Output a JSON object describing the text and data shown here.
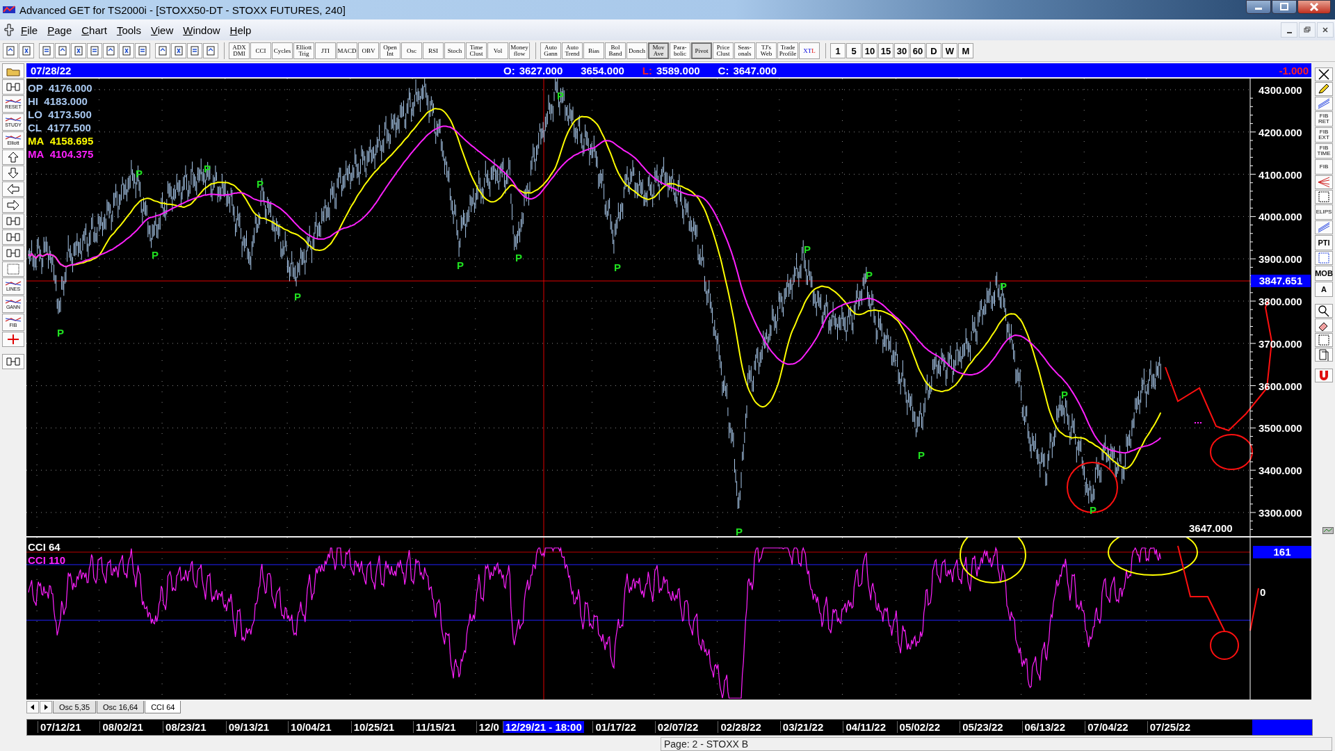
{
  "window": {
    "title": "Advanced GET for TS2000i - [STOXX50-DT - STOXX FUTURES, 240]"
  },
  "menu": [
    "File",
    "Page",
    "Chart",
    "Tools",
    "View",
    "Window",
    "Help"
  ],
  "indicator_buttons": [
    {
      "label": "ADX\nDMI",
      "on": false
    },
    {
      "label": "CCI",
      "on": false
    },
    {
      "label": "Cycles",
      "on": false
    },
    {
      "label": "Elliott\nTrig",
      "on": false
    },
    {
      "label": "JTI",
      "on": false
    },
    {
      "label": "MACD",
      "on": false
    },
    {
      "label": "OBV",
      "on": false
    },
    {
      "label": "Open\nInt",
      "on": false
    },
    {
      "label": "Osc",
      "on": false
    },
    {
      "label": "RSI",
      "on": false
    },
    {
      "label": "Stoch",
      "on": false
    },
    {
      "label": "Time\nClust",
      "on": false
    },
    {
      "label": "Vol",
      "on": false
    },
    {
      "label": "Money\nflow",
      "on": false
    }
  ],
  "study_buttons": [
    {
      "label": "Auto\nGann",
      "on": false,
      "kind": "text"
    },
    {
      "label": "Auto\nTrend",
      "on": false,
      "kind": "text"
    },
    {
      "label": "Bias",
      "on": false,
      "kind": "text"
    },
    {
      "label": "Bol\nBand",
      "on": false,
      "kind": "text"
    },
    {
      "label": "Donch",
      "on": false,
      "kind": "text"
    },
    {
      "label": "Mov\nAve",
      "on": true,
      "kind": "text"
    },
    {
      "label": "Para-\nbolic",
      "on": false,
      "kind": "text"
    },
    {
      "label": "Pivot",
      "on": true,
      "kind": "text"
    },
    {
      "label": "Price\nClust",
      "on": false,
      "kind": "text"
    },
    {
      "label": "Seas-\nonals",
      "on": false,
      "kind": "text"
    },
    {
      "label": "TJ's\nWeb",
      "on": false,
      "kind": "text"
    },
    {
      "label": "Trade\nProfile",
      "on": false,
      "kind": "text"
    },
    {
      "label": "XTL",
      "on": false,
      "kind": "xtl"
    }
  ],
  "timeframes": [
    "1",
    "5",
    "10",
    "15",
    "30",
    "60",
    "D",
    "W",
    "M"
  ],
  "left_toolbar": [
    "RESET",
    "STUDY",
    "Elliott",
    "LINES",
    "GANN",
    "FIB"
  ],
  "right_toolbar": [
    "FIB\nRET",
    "FIB\nEXT",
    "FIB\nTIME",
    "FIB",
    "ELIPS",
    "PTI",
    "MOB",
    "A"
  ],
  "info_bar": {
    "date": "07/28/22",
    "items": [
      {
        "label": "O:",
        "value": "3627.000",
        "alert": false
      },
      {
        "value": "3654.000"
      },
      {
        "label": "L:",
        "value": "3589.000",
        "alert": true
      },
      {
        "label": "C:",
        "value": "3647.000",
        "alert": false
      }
    ],
    "change": "-1.000"
  },
  "price_chart": {
    "legend": [
      {
        "label": "OP",
        "value": "4176.000",
        "color": "#a8c8f0"
      },
      {
        "label": "HI",
        "value": "4183.000",
        "color": "#a8c8f0"
      },
      {
        "label": "LO",
        "value": "4173.500",
        "color": "#a8c8f0"
      },
      {
        "label": "CL",
        "value": "4177.500",
        "color": "#a8c8f0"
      },
      {
        "label": "MA",
        "value": "4158.695",
        "color": "#ffff00"
      },
      {
        "label": "MA",
        "value": "4104.375",
        "color": "#ff20ff"
      }
    ],
    "y_axis": [
      "4300.000",
      "4200.000",
      "4100.000",
      "4000.000",
      "3900.000",
      "3800.000",
      "3700.000",
      "3600.000",
      "3500.000",
      "3400.000",
      "3300.000"
    ],
    "current_price": "3847.651",
    "last_price": "3647.000",
    "pivot_labels": [
      "P",
      "P",
      "P",
      "P",
      "P",
      "P",
      "P",
      "P",
      "P",
      "P",
      "P",
      "P",
      "P",
      "P",
      "P",
      "P",
      "P"
    ]
  },
  "cci_chart": {
    "legend": [
      {
        "label": "CCI 64",
        "color": "#ffffff"
      },
      {
        "label": "CCI  110",
        "color": "#ff20ff"
      }
    ],
    "current_value": "161",
    "zero_label": "0"
  },
  "tabs": [
    {
      "label": "Osc 5,35",
      "selected": false
    },
    {
      "label": "Osc 16,64",
      "selected": false
    },
    {
      "label": "CCI 64",
      "selected": true
    }
  ],
  "date_axis": [
    {
      "label": "07/12/21",
      "selected": false
    },
    {
      "label": "08/02/21",
      "selected": false
    },
    {
      "label": "08/23/21",
      "selected": false
    },
    {
      "label": "09/13/21",
      "selected": false
    },
    {
      "label": "10/04/21",
      "selected": false
    },
    {
      "label": "10/25/21",
      "selected": false
    },
    {
      "label": "11/15/21",
      "selected": false
    },
    {
      "label": "12/0",
      "selected": false
    },
    {
      "label": "12/29/21 - 18:00",
      "selected": true
    },
    {
      "label": "01/17/22",
      "selected": false
    },
    {
      "label": "02/07/22",
      "selected": false
    },
    {
      "label": "02/28/22",
      "selected": false
    },
    {
      "label": "03/21/22",
      "selected": false
    },
    {
      "label": "04/11/22",
      "selected": false
    },
    {
      "label": "05/02/22",
      "selected": false
    },
    {
      "label": "05/23/22",
      "selected": false
    },
    {
      "label": "06/13/22",
      "selected": false
    },
    {
      "label": "07/04/22",
      "selected": false
    },
    {
      "label": "07/25/22",
      "selected": false
    }
  ],
  "status_bar": "Page: 2 - STOXX B"
}
